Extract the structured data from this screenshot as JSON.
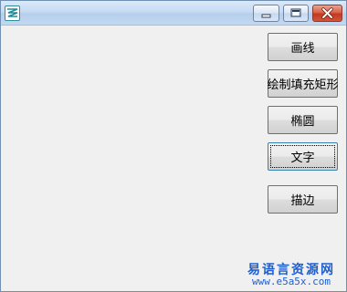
{
  "window": {
    "title": "",
    "icon": "app-logo-icon",
    "controls": [
      "minimize-icon",
      "maximize-icon",
      "close-icon"
    ]
  },
  "buttons": [
    {
      "label": "画线"
    },
    {
      "label": "绘制填充矩形"
    },
    {
      "label": "椭圆"
    },
    {
      "label": "文字",
      "focused": true
    },
    {
      "label": "描边"
    }
  ],
  "watermark": {
    "title": "易语言资源网",
    "url": "www.e5a5x.com"
  },
  "colors": {
    "accent": "#1f5fcf",
    "close": "#c4391f"
  }
}
